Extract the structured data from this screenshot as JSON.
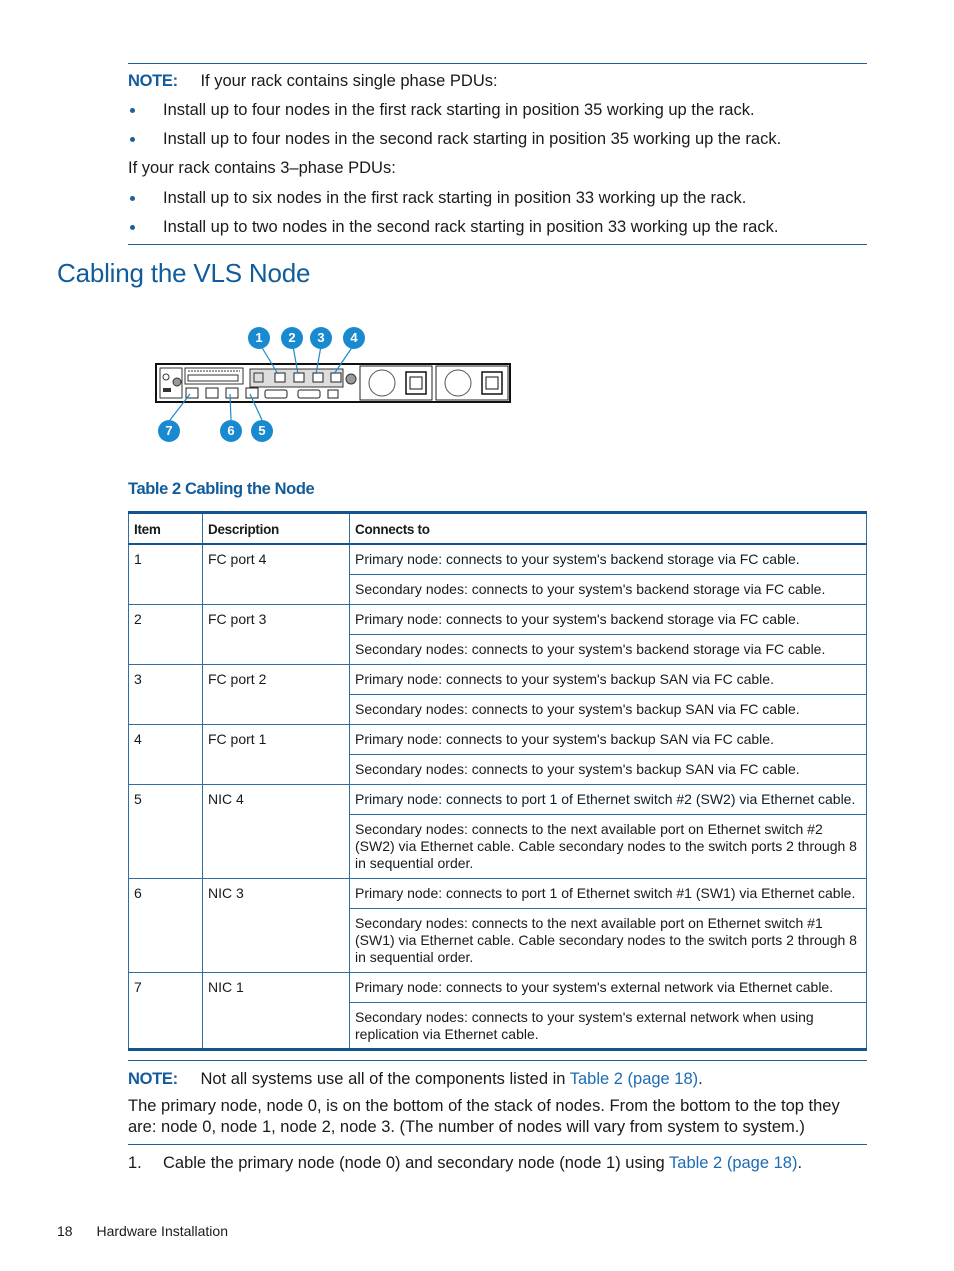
{
  "note_top": {
    "label": "NOTE:",
    "intro": "If your rack contains single phase PDUs:",
    "single_phase_items": [
      "Install up to four nodes in the first rack starting in position 35 working up the rack.",
      "Install up to four nodes in the second rack starting in position 35 working up the rack."
    ],
    "three_phase_intro": "If your rack contains 3–phase PDUs:",
    "three_phase_items": [
      "Install up to six nodes in the first rack starting in position 33 working up the rack.",
      "Install up to two nodes in the second rack starting in position 33 working up the rack."
    ]
  },
  "section": {
    "title": "Cabling the VLS Node"
  },
  "figure": {
    "callouts_top": [
      "1",
      "2",
      "3",
      "4"
    ],
    "callouts_bottom": [
      "7",
      "6",
      "5"
    ],
    "accent_color": "#1a8ad0"
  },
  "table": {
    "caption": "Table 2 Cabling the Node",
    "headers": [
      "Item",
      "Description",
      "Connects to"
    ],
    "rows": [
      {
        "item": "1",
        "description": "FC port 4",
        "primary": "Primary node: connects to your system's backend storage via FC cable.",
        "secondary": "Secondary nodes: connects to your system's backend storage via FC cable."
      },
      {
        "item": "2",
        "description": "FC port 3",
        "primary": "Primary node: connects to your system's backend storage via FC cable.",
        "secondary": "Secondary nodes: connects to your system's backend storage via FC cable."
      },
      {
        "item": "3",
        "description": "FC port 2",
        "primary": "Primary node: connects to your system's backup SAN via FC cable.",
        "secondary": "Secondary nodes: connects to your system's backup SAN via FC cable."
      },
      {
        "item": "4",
        "description": "FC port 1",
        "primary": "Primary node: connects to your system's backup SAN via FC cable.",
        "secondary": "Secondary nodes: connects to your system's backup SAN via FC cable."
      },
      {
        "item": "5",
        "description": "NIC 4",
        "primary": "Primary node: connects to port 1 of Ethernet switch #2 (SW2) via Ethernet cable.",
        "secondary": "Secondary nodes: connects to the next available port on Ethernet switch #2 (SW2) via Ethernet cable. Cable secondary nodes to the switch ports 2 through 8 in sequential order."
      },
      {
        "item": "6",
        "description": "NIC 3",
        "primary": "Primary node: connects to port 1 of Ethernet switch #1 (SW1) via Ethernet cable.",
        "secondary": "Secondary nodes: connects to the next available port on Ethernet switch #1 (SW1) via Ethernet cable. Cable secondary nodes to the switch ports 2 through 8 in sequential order."
      },
      {
        "item": "7",
        "description": "NIC 1",
        "primary": "Primary node: connects to your system's external network via Ethernet cable.",
        "secondary": "Secondary nodes: connects to your system's external network when using replication via Ethernet cable."
      }
    ]
  },
  "note_bottom": {
    "label": "NOTE:",
    "text": "Not all systems use all of the components listed in ",
    "link": "Table 2 (page 18)",
    "tail": ".",
    "paragraph_line1": "The primary node, node 0, is on the bottom of the stack of nodes. From the bottom to the top they",
    "paragraph_line2": "are: node 0, node 1, node 2, node 3. (The number of nodes will vary from system to system.)"
  },
  "step1": {
    "number": "1.",
    "text": "Cable the primary node (node 0) and secondary node (node 1) using ",
    "link": "Table 2 (page 18)",
    "tail": "."
  },
  "footer": {
    "page_number": "18",
    "section": "Hardware Installation"
  }
}
